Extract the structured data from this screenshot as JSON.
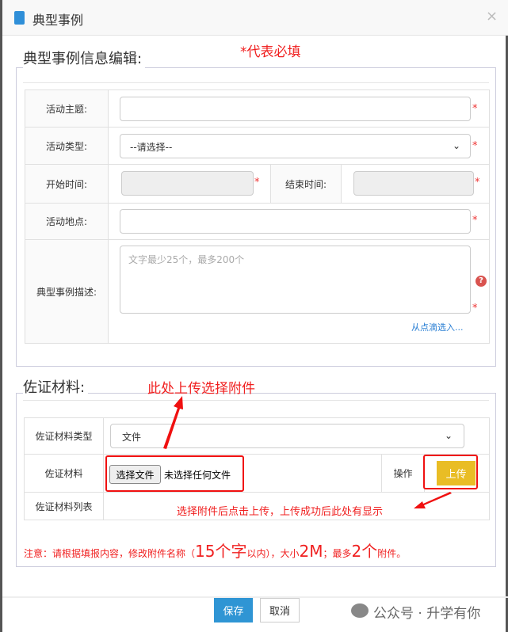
{
  "dialog": {
    "title": "典型事例",
    "close": "×"
  },
  "section1": {
    "legend": "典型事例信息编辑:",
    "required_note": "*代表必填",
    "fields": {
      "topic": "活动主题:",
      "type": "活动类型:",
      "type_value": "--请选择--",
      "start": "开始时间:",
      "end": "结束时间:",
      "place": "活动地点:",
      "desc": "典型事例描述:",
      "desc_placeholder": "文字最少25个，最多200个",
      "desc_link": "从点滴选入...",
      "required": "*",
      "help": "?"
    }
  },
  "section2": {
    "legend": "佐证材料:",
    "annotation_top": "此处上传选择附件",
    "type_label": "佐证材料类型",
    "type_value": "文件",
    "material_label": "佐证材料",
    "choose_file": "选择文件",
    "no_file": "未选择任何文件",
    "op_label": "操作",
    "upload": "上传",
    "list_label": "佐证材料列表",
    "annotation_list": "选择附件后点击上传，上传成功后此处有显示",
    "note": {
      "a": "注意：请根据填报内容，修改附件名称（",
      "b": "15个字",
      "c": "以内），大小",
      "d": "2M",
      "e": "；最多",
      "f": "2个",
      "g": "附件。"
    }
  },
  "footer": {
    "save": "保存",
    "cancel": "取消",
    "watermark": "公众号 · 升学有你"
  }
}
